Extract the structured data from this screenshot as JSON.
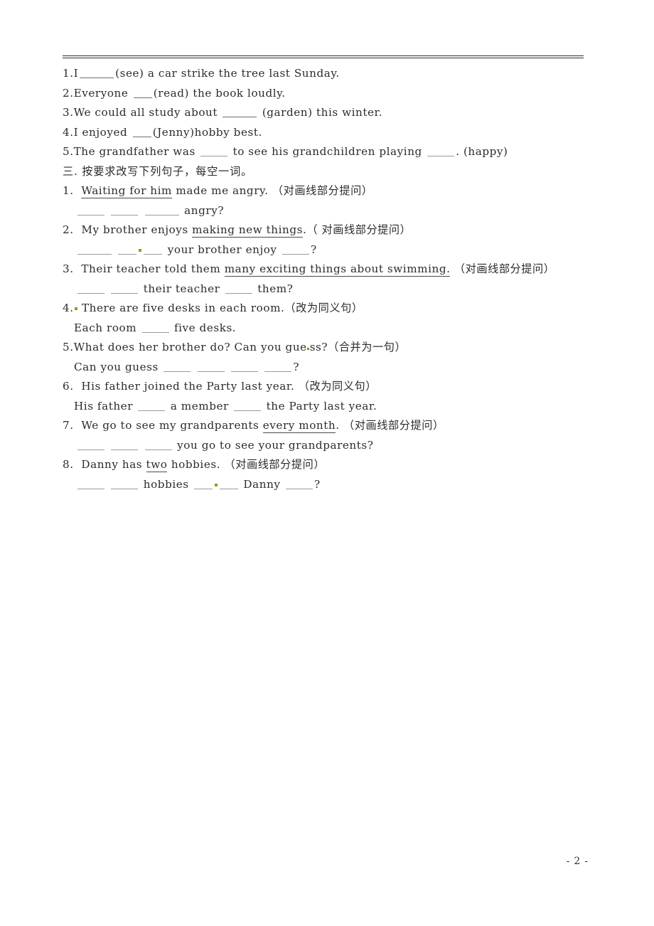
{
  "page": {
    "footer_label": "- 2 -"
  },
  "section_two_items": [
    {
      "number": "1.",
      "pre": "I",
      "post": "(see) a car strike the tree last Sunday."
    },
    {
      "number": "2.",
      "pre": "Everyone",
      "post": "(read) the book loudly."
    },
    {
      "number": "3.",
      "pre": "We could all study about",
      "post": "(garden) this winter."
    },
    {
      "number": "4.",
      "pre": "I enjoyed",
      "post": "(Jenny)hobby best."
    },
    {
      "number": "5.",
      "pre": "The grandfather was",
      "mid": "to see his grandchildren playing",
      "post": ". (happy)"
    }
  ],
  "section_three": {
    "heading": "三. 按要求改写下列句子，每空一词。",
    "items": [
      {
        "number": "1.",
        "q_pre": "",
        "q_underlined": "Waiting for him",
        "q_post": "made me angry.",
        "q_paren": "（对画线部分提问）",
        "a_tail": "angry?"
      },
      {
        "number": "2.",
        "q_pre": "My brother enjoys",
        "q_underlined": "making new things",
        "q_post": ".",
        "q_paren": "（ 对画线部分提问）",
        "a_mid": "your brother enjoy",
        "a_tail": "?"
      },
      {
        "number": "3.",
        "q_pre": "Their teacher told them",
        "q_underlined": "many exciting things about swimming.",
        "q_post": "",
        "q_paren": "（对画线部分提问）",
        "a_mid": "their teacher",
        "a_tail": "them?"
      },
      {
        "number": "4.",
        "q_text": "There are five desks in each room.",
        "q_paren": "（改为同义句）",
        "a_pre": "Each room",
        "a_tail": "five desks."
      },
      {
        "number": "5.",
        "q_text_a": "What does her brother do? Can you gue",
        "q_text_b": "ss?",
        "q_paren": "（合并为一句）",
        "a_pre": "Can you guess",
        "a_tail": "?"
      },
      {
        "number": "6.",
        "q_text": "His father joined the Party last year.",
        "q_paren": "（改为同义句）",
        "a_pre": "His father",
        "a_mid": "a member",
        "a_tail": "the Party last year."
      },
      {
        "number": "7.",
        "q_pre": "We go to see my grandparents",
        "q_underlined": "every month",
        "q_post": ".",
        "q_paren": "（对画线部分提问）",
        "a_tail": "you go to see your grandparents?"
      },
      {
        "number": "8.",
        "q_pre": "Danny has",
        "q_underlined": "two",
        "q_post": "hobbies.",
        "q_paren": "（对画线部分提问）",
        "a_mid": "hobbies",
        "a_mid2": "Danny",
        "a_tail": "?"
      }
    ]
  }
}
